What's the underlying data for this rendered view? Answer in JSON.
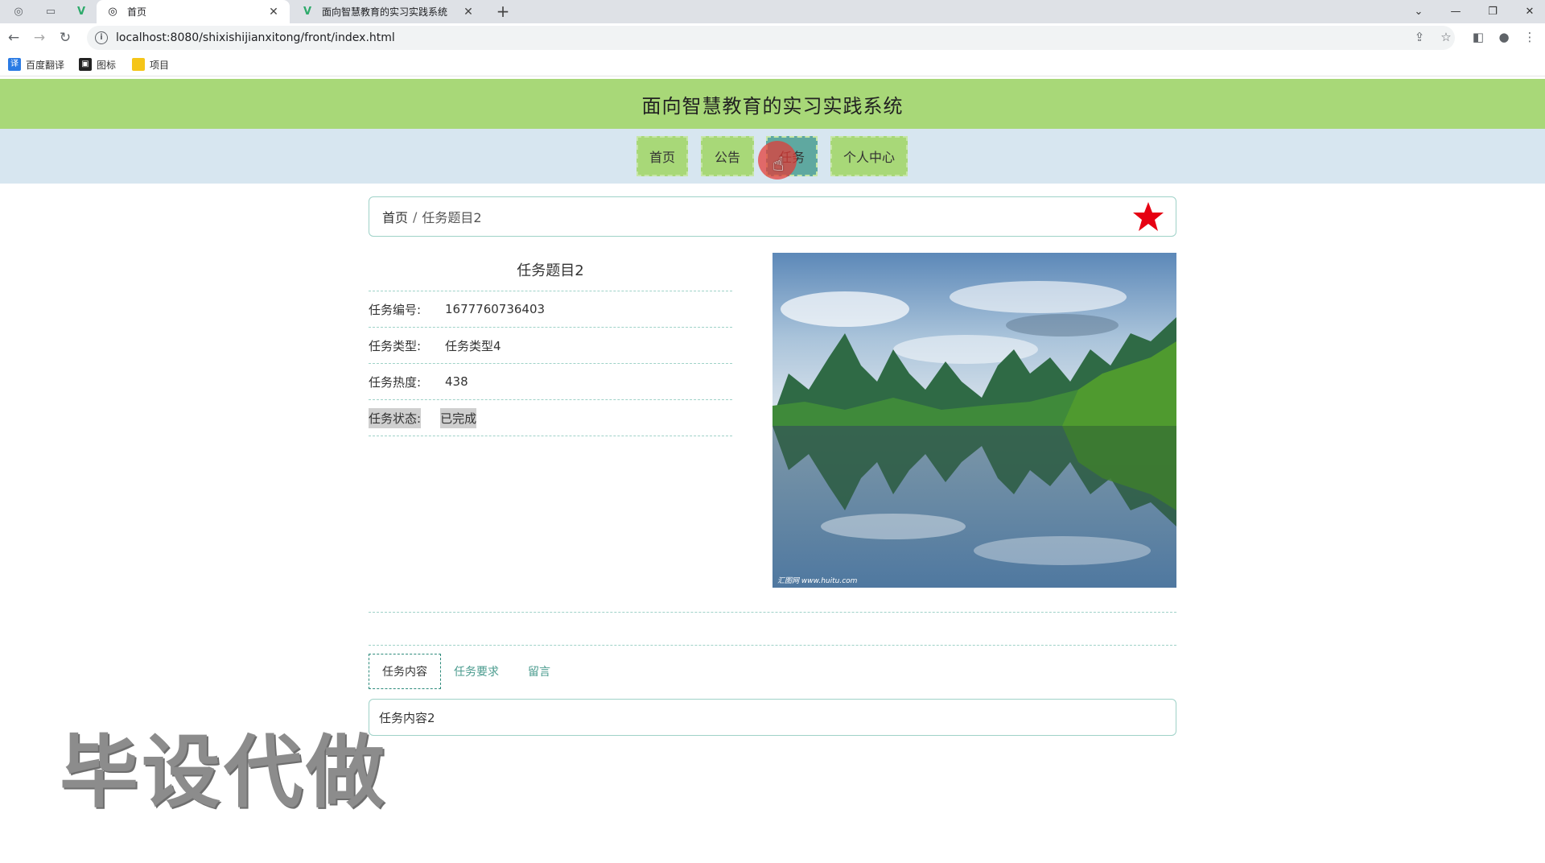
{
  "browser": {
    "tabs": [
      {
        "title": "首页",
        "active": true
      },
      {
        "title": "面向智慧教育的实习实践系统",
        "active": false
      }
    ],
    "url": "localhost:8080/shixishijianxitong/front/index.html",
    "bookmarks": [
      "百度翻译",
      "图标",
      "项目"
    ]
  },
  "site": {
    "title": "面向智慧教育的实习实践系统",
    "nav": [
      "首页",
      "公告",
      "任务",
      "个人中心"
    ],
    "active_nav": "任务"
  },
  "breadcrumb": {
    "home": "首页",
    "separator": "/",
    "current": "任务题目2"
  },
  "detail": {
    "title": "任务题目2",
    "fields": [
      {
        "label": "任务编号:",
        "value": "1677760736403"
      },
      {
        "label": "任务类型:",
        "value": "任务类型4"
      },
      {
        "label": "任务热度:",
        "value": "438"
      },
      {
        "label": "任务状态:",
        "value": "已完成"
      }
    ],
    "image_watermark": "汇图网 www.huitu.com"
  },
  "tabs": {
    "items": [
      "任务内容",
      "任务要求",
      "留言"
    ],
    "active": "任务内容",
    "content": "任务内容2"
  },
  "overlay": "毕设代做",
  "colors": {
    "header_green": "#a8d878",
    "nav_bg": "#d7e6f0",
    "nav_active": "#5fa8a0",
    "accent_teal": "#4a9b8e",
    "star_red": "#e60012"
  }
}
